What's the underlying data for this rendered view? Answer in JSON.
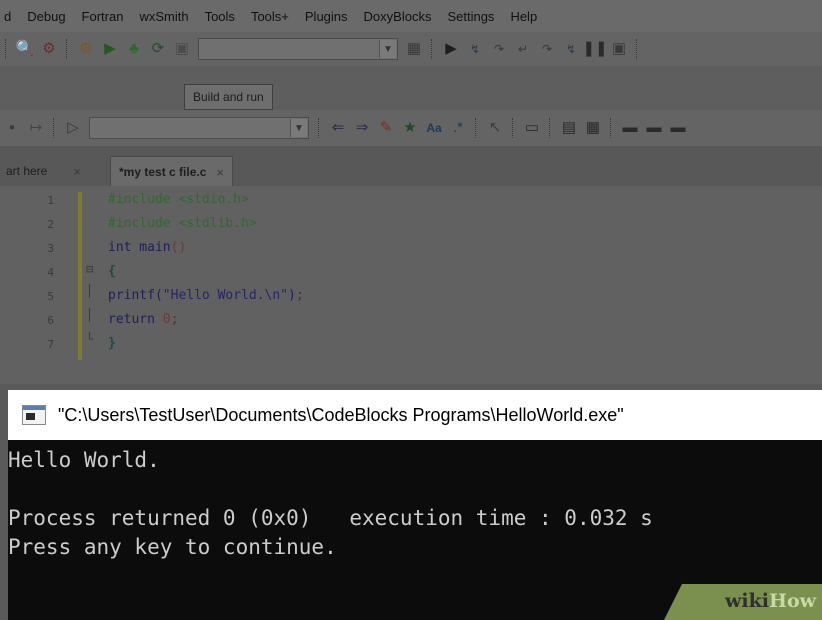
{
  "menu": [
    "d",
    "Debug",
    "Fortran",
    "wxSmith",
    "Tools",
    "Tools+",
    "Plugins",
    "DoxyBlocks",
    "Settings",
    "Help"
  ],
  "toolbar": {
    "build_run_tooltip": "Build and run"
  },
  "tabs": [
    {
      "label": "art here",
      "active": false
    },
    {
      "label": "*my test c file.c",
      "active": true
    }
  ],
  "tab_close_glyph": "×",
  "editor": {
    "line_numbers": [
      "1",
      "2",
      "3",
      "4",
      "5",
      "6",
      "7"
    ],
    "lines": [
      {
        "parts": [
          [
            "pp",
            "#include <stdio.h>"
          ]
        ]
      },
      {
        "parts": [
          [
            "pp",
            "#include <stdlib.h>"
          ]
        ]
      },
      {
        "parts": [
          [
            "kw",
            "int main"
          ],
          [
            "num",
            "()"
          ]
        ]
      },
      {
        "parts": [
          [
            "brk",
            "{"
          ]
        ]
      },
      {
        "parts": [
          [
            "kw",
            "printf("
          ],
          [
            "str",
            "\"Hello World.\\n\""
          ],
          [
            "kw",
            ")"
          ],
          [
            "semi",
            ";"
          ]
        ]
      },
      {
        "parts": [
          [
            "kw",
            "return "
          ],
          [
            "num",
            "0"
          ],
          [
            "semi",
            ";"
          ]
        ]
      },
      {
        "parts": [
          [
            "brk",
            "}"
          ]
        ]
      }
    ]
  },
  "console": {
    "title": "\"C:\\Users\\TestUser\\Documents\\CodeBlocks Programs\\HelloWorld.exe\"",
    "output": [
      "Hello World.",
      "",
      "Process returned 0 (0x0)   execution time : 0.032 s",
      "Press any key to continue."
    ]
  },
  "watermark": {
    "part1": "wiki",
    "part2": "How"
  },
  "icons": [
    "search-icon",
    "replace-icon",
    "gear-build-icon",
    "run-icon",
    "build-run-icon",
    "rebuild-icon",
    "stop-icon",
    "build-target-icon",
    "debug-run-icon",
    "step-over-icon",
    "step-into-icon",
    "step-out-icon",
    "next-instruction-icon",
    "step-instruction-icon",
    "break-icon",
    "stop-debug-icon",
    "jump-back-icon",
    "jump-forward-icon",
    "highlight-icon",
    "match-icon",
    "font-icon",
    "regex-icon",
    "selection-icon",
    "comment-icon",
    "window-icon",
    "fold-minus-icon"
  ],
  "colors": {
    "console_bg": "#0c0c0c",
    "console_text": "#cccccc",
    "preprocessor": "#2e6a2e",
    "change_bar": "#817b35",
    "watermark_bg": "#7b8f4f"
  }
}
